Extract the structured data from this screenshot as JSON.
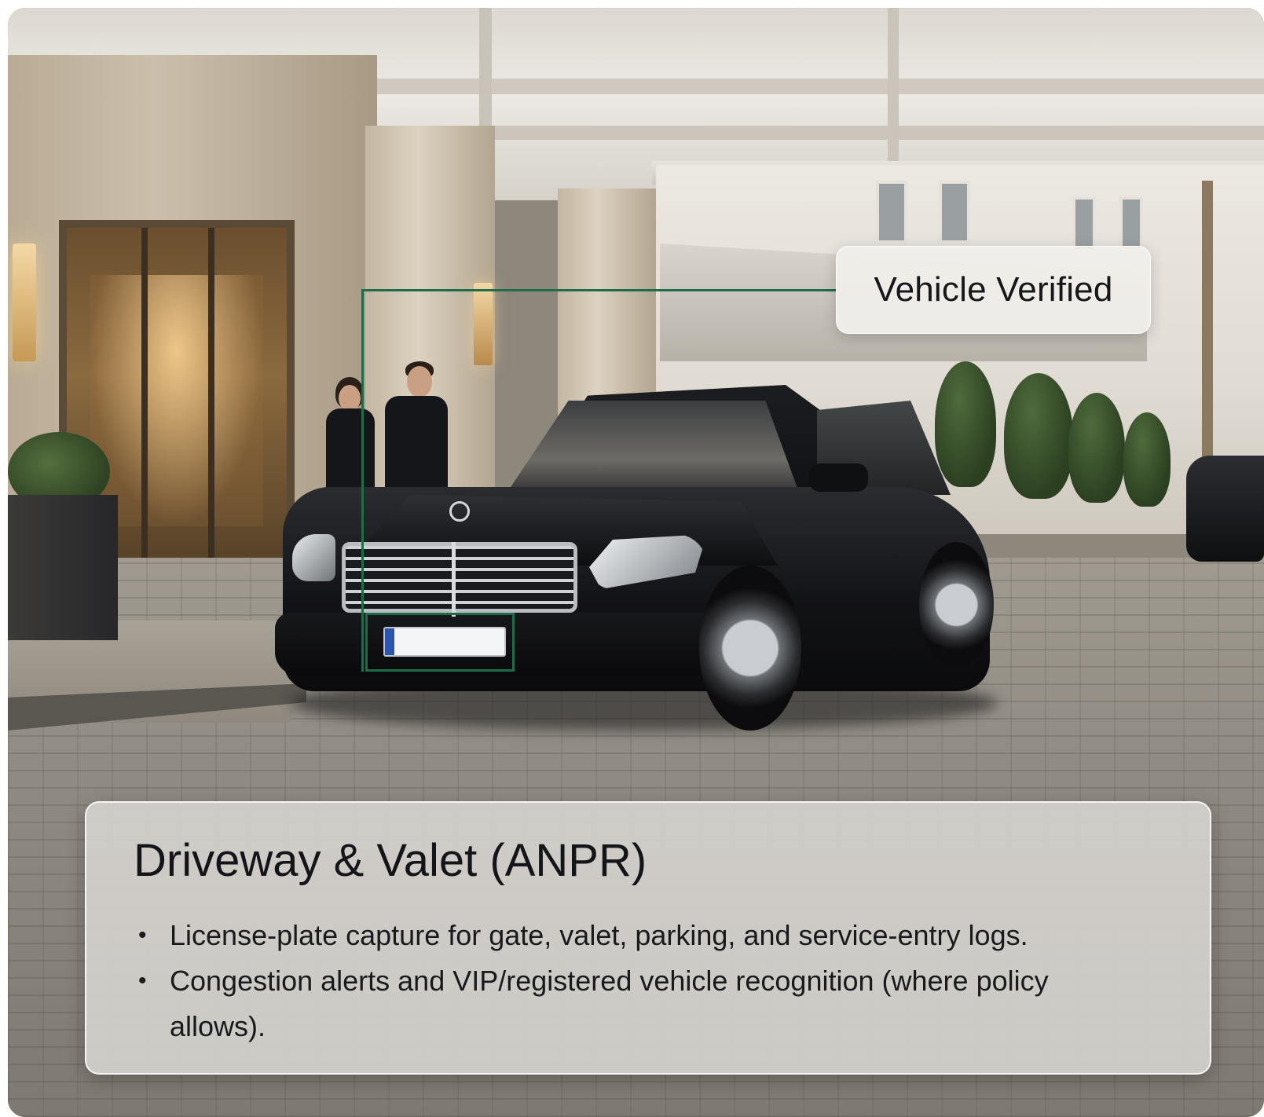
{
  "overlay_label": "Vehicle Verified",
  "info": {
    "title": "Driveway & Valet (ANPR)",
    "bullets": [
      "License-plate capture for gate, valet, parking, and service-entry logs.",
      "Congestion alerts and VIP/registered vehicle recognition (where policy allows)."
    ]
  },
  "colors": {
    "detection_box": "#1f6b4a",
    "panel_background": "#d4d1cd",
    "text": "#141518"
  },
  "scene": {
    "subject": "black luxury sedan at hotel entrance porte-cochère",
    "icons": [
      "bullet-dot"
    ]
  }
}
